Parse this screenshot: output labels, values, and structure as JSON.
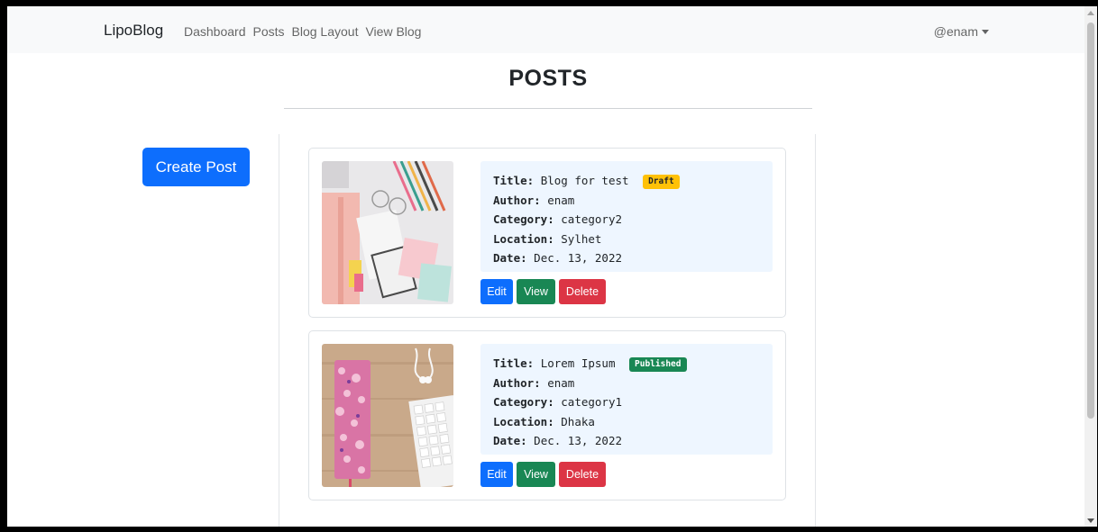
{
  "navbar": {
    "brand": "LipoBlog",
    "links": [
      "Dashboard",
      "Posts",
      "Blog Layout",
      "View Blog"
    ],
    "user": "@enam"
  },
  "page": {
    "title": "POSTS",
    "create_button": "Create Post"
  },
  "labels": {
    "title": "Title:",
    "author": "Author:",
    "category": "Category:",
    "location": "Location:",
    "date": "Date:"
  },
  "posts": [
    {
      "title": "Blog for test",
      "status": "Draft",
      "author": "enam",
      "category": "category2",
      "location": "Sylhet",
      "date": "Dec. 13, 2022",
      "actions": [
        "Edit",
        "View",
        "Delete"
      ]
    },
    {
      "title": "Lorem Ipsum",
      "status": "Published",
      "author": "enam",
      "category": "category1",
      "location": "Dhaka",
      "date": "Dec. 13, 2022",
      "actions": [
        "Edit",
        "View",
        "Delete"
      ]
    }
  ],
  "colors": {
    "primary": "#0d6efd",
    "success": "#198754",
    "danger": "#dc3545",
    "warning": "#ffc107"
  },
  "icons": {
    "user_menu": "caret-down-icon"
  }
}
